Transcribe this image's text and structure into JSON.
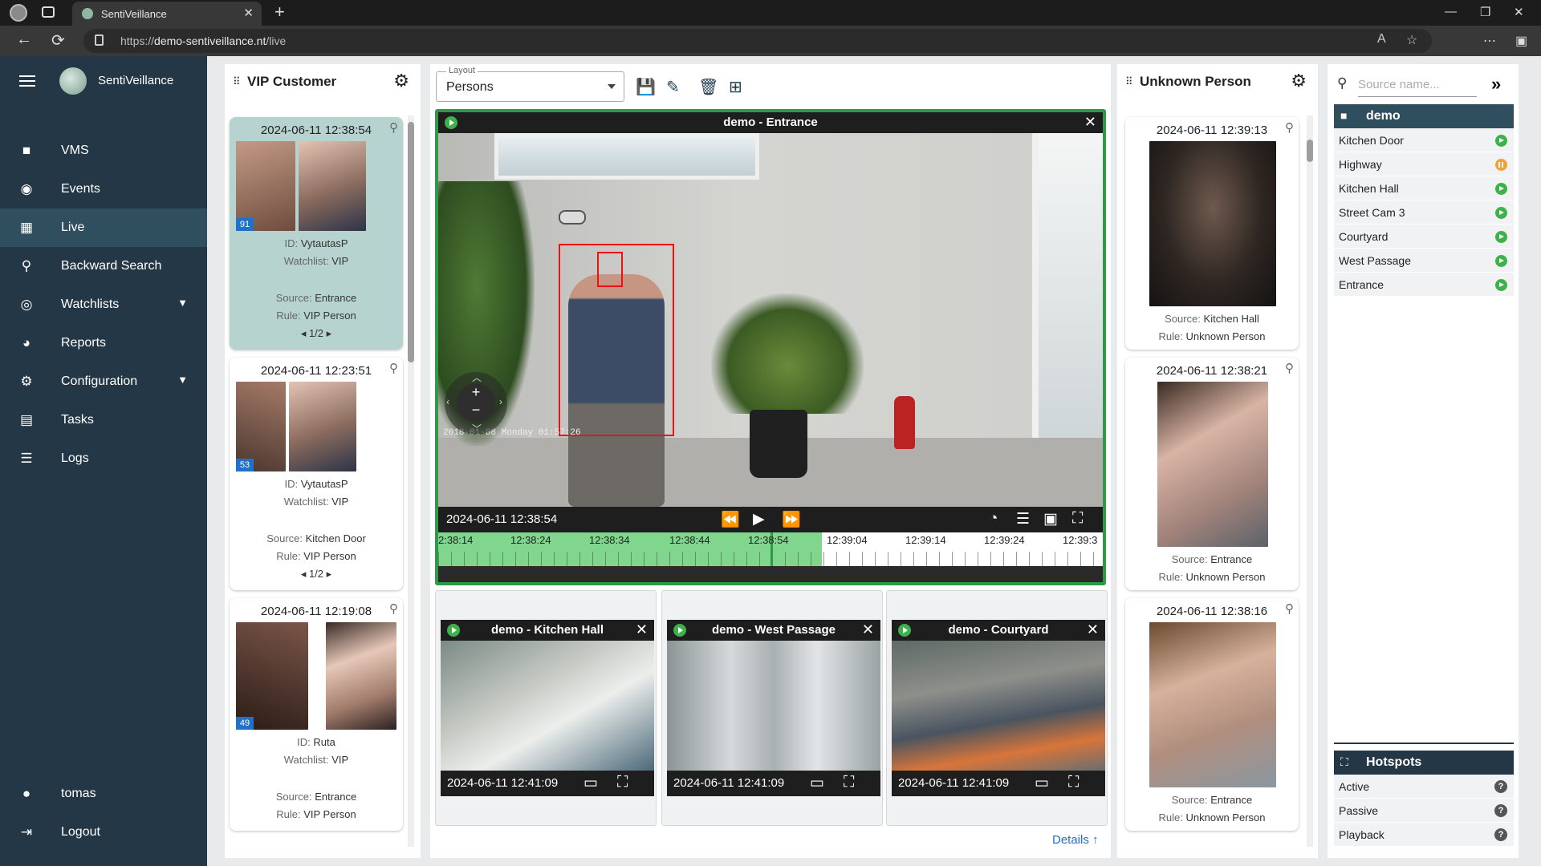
{
  "browser": {
    "tab_title": "SentiVeillance",
    "url_prefix": "https://",
    "url_host": "demo-sentiveillance.nt",
    "url_path": "/live"
  },
  "sidebar": {
    "brand": "SentiVeillance",
    "items": [
      {
        "label": "VMS",
        "icon": "video-camera-icon"
      },
      {
        "label": "Events",
        "icon": "aperture-icon"
      },
      {
        "label": "Live",
        "icon": "dashboard-icon",
        "active": true
      },
      {
        "label": "Backward Search",
        "icon": "search-icon"
      },
      {
        "label": "Watchlists",
        "icon": "eye-icon",
        "expandable": true
      },
      {
        "label": "Reports",
        "icon": "pie-chart-icon"
      },
      {
        "label": "Configuration",
        "icon": "gear-icon",
        "expandable": true
      },
      {
        "label": "Tasks",
        "icon": "clipboard-icon"
      },
      {
        "label": "Logs",
        "icon": "list-icon"
      }
    ],
    "user": "tomas",
    "logout": "Logout"
  },
  "vip_panel": {
    "title": "VIP Customer",
    "events": [
      {
        "time": "2024-06-11 12:38:54",
        "score": "91",
        "id": "VytautasP",
        "watchlist": "VIP",
        "source": "Entrance",
        "rule": "VIP Person",
        "pager": "1/2",
        "selected": true
      },
      {
        "time": "2024-06-11 12:23:51",
        "score": "53",
        "id": "VytautasP",
        "watchlist": "VIP",
        "source": "Kitchen Door",
        "rule": "VIP Person",
        "pager": "1/2"
      },
      {
        "time": "2024-06-11 12:19:08",
        "score": "49",
        "id": "Ruta",
        "watchlist": "VIP",
        "source": "Entrance",
        "rule": "VIP Person"
      }
    ]
  },
  "labels": {
    "id": "ID:",
    "watchlist": "Watchlist:",
    "source": "Source:",
    "rule": "Rule:"
  },
  "layout": {
    "label": "Layout",
    "value": "Persons"
  },
  "main_cam": {
    "title": "demo - Entrance",
    "osd": "2018-01-08 Monday 01:57:26",
    "time": "2024-06-11 12:38:54",
    "timeline": [
      "2:38:14",
      "12:38:24",
      "12:38:34",
      "12:38:44",
      "12:38:54",
      "12:39:04",
      "12:39:14",
      "12:39:24",
      "12:39:3"
    ]
  },
  "small_cams": [
    {
      "title": "demo - Kitchen Hall",
      "time": "2024-06-11 12:41:09"
    },
    {
      "title": "demo - West Passage",
      "time": "2024-06-11 12:41:09"
    },
    {
      "title": "demo - Courtyard",
      "time": "2024-06-11 12:41:09"
    }
  ],
  "details_label": "Details",
  "unknown_panel": {
    "title": "Unknown Person",
    "events": [
      {
        "time": "2024-06-11 12:39:13",
        "source": "Kitchen Hall",
        "rule": "Unknown Person"
      },
      {
        "time": "2024-06-11 12:38:21",
        "source": "Entrance",
        "rule": "Unknown Person"
      },
      {
        "time": "2024-06-11 12:38:16",
        "source": "Entrance",
        "rule": "Unknown Person"
      }
    ]
  },
  "sources": {
    "placeholder": "Source name...",
    "group": "demo",
    "items": [
      {
        "name": "Kitchen Door",
        "status": "playing"
      },
      {
        "name": "Highway",
        "status": "paused"
      },
      {
        "name": "Kitchen Hall",
        "status": "playing"
      },
      {
        "name": "Street Cam 3",
        "status": "playing"
      },
      {
        "name": "Courtyard",
        "status": "playing"
      },
      {
        "name": "West Passage",
        "status": "playing"
      },
      {
        "name": "Entrance",
        "status": "playing"
      }
    ]
  },
  "hotspots": {
    "title": "Hotspots",
    "items": [
      "Active",
      "Passive",
      "Playback"
    ]
  },
  "colors": {
    "sidebar": "#243746",
    "active": "#2f4e5e",
    "selected_card": "#b7d3cf",
    "playing": "#3db24a",
    "paused": "#f0a23a",
    "link": "#2170c9"
  }
}
